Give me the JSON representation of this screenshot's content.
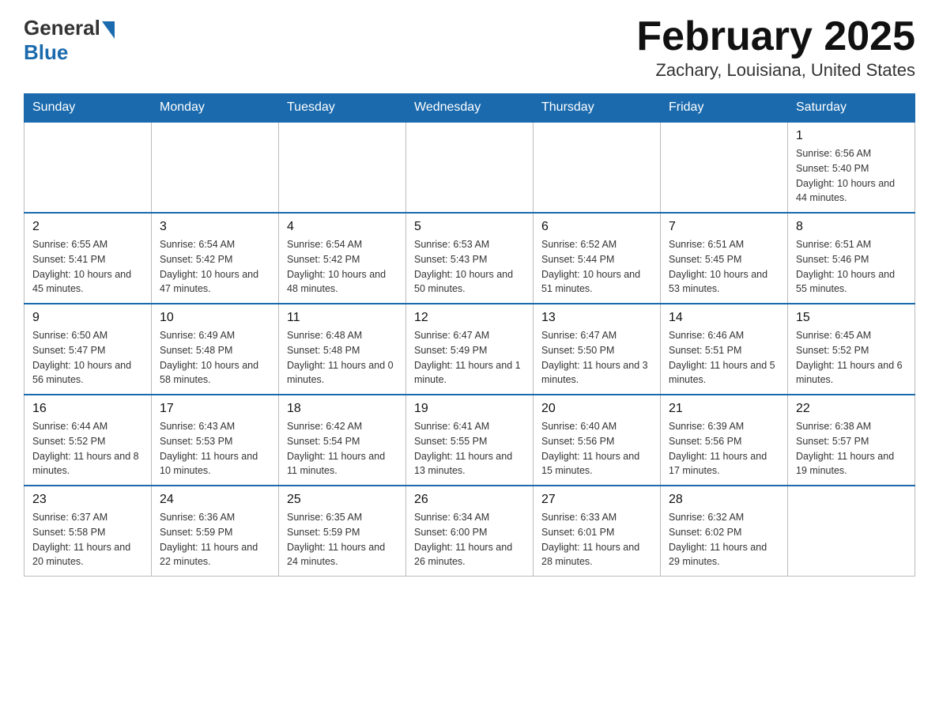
{
  "logo": {
    "general": "General",
    "blue": "Blue"
  },
  "header": {
    "title": "February 2025",
    "location": "Zachary, Louisiana, United States"
  },
  "days_of_week": [
    "Sunday",
    "Monday",
    "Tuesday",
    "Wednesday",
    "Thursday",
    "Friday",
    "Saturday"
  ],
  "weeks": [
    [
      {
        "day": "",
        "info": "",
        "empty": true
      },
      {
        "day": "",
        "info": "",
        "empty": true
      },
      {
        "day": "",
        "info": "",
        "empty": true
      },
      {
        "day": "",
        "info": "",
        "empty": true
      },
      {
        "day": "",
        "info": "",
        "empty": true
      },
      {
        "day": "",
        "info": "",
        "empty": true
      },
      {
        "day": "1",
        "info": "Sunrise: 6:56 AM\nSunset: 5:40 PM\nDaylight: 10 hours and 44 minutes.",
        "empty": false
      }
    ],
    [
      {
        "day": "2",
        "info": "Sunrise: 6:55 AM\nSunset: 5:41 PM\nDaylight: 10 hours and 45 minutes.",
        "empty": false
      },
      {
        "day": "3",
        "info": "Sunrise: 6:54 AM\nSunset: 5:42 PM\nDaylight: 10 hours and 47 minutes.",
        "empty": false
      },
      {
        "day": "4",
        "info": "Sunrise: 6:54 AM\nSunset: 5:42 PM\nDaylight: 10 hours and 48 minutes.",
        "empty": false
      },
      {
        "day": "5",
        "info": "Sunrise: 6:53 AM\nSunset: 5:43 PM\nDaylight: 10 hours and 50 minutes.",
        "empty": false
      },
      {
        "day": "6",
        "info": "Sunrise: 6:52 AM\nSunset: 5:44 PM\nDaylight: 10 hours and 51 minutes.",
        "empty": false
      },
      {
        "day": "7",
        "info": "Sunrise: 6:51 AM\nSunset: 5:45 PM\nDaylight: 10 hours and 53 minutes.",
        "empty": false
      },
      {
        "day": "8",
        "info": "Sunrise: 6:51 AM\nSunset: 5:46 PM\nDaylight: 10 hours and 55 minutes.",
        "empty": false
      }
    ],
    [
      {
        "day": "9",
        "info": "Sunrise: 6:50 AM\nSunset: 5:47 PM\nDaylight: 10 hours and 56 minutes.",
        "empty": false
      },
      {
        "day": "10",
        "info": "Sunrise: 6:49 AM\nSunset: 5:48 PM\nDaylight: 10 hours and 58 minutes.",
        "empty": false
      },
      {
        "day": "11",
        "info": "Sunrise: 6:48 AM\nSunset: 5:48 PM\nDaylight: 11 hours and 0 minutes.",
        "empty": false
      },
      {
        "day": "12",
        "info": "Sunrise: 6:47 AM\nSunset: 5:49 PM\nDaylight: 11 hours and 1 minute.",
        "empty": false
      },
      {
        "day": "13",
        "info": "Sunrise: 6:47 AM\nSunset: 5:50 PM\nDaylight: 11 hours and 3 minutes.",
        "empty": false
      },
      {
        "day": "14",
        "info": "Sunrise: 6:46 AM\nSunset: 5:51 PM\nDaylight: 11 hours and 5 minutes.",
        "empty": false
      },
      {
        "day": "15",
        "info": "Sunrise: 6:45 AM\nSunset: 5:52 PM\nDaylight: 11 hours and 6 minutes.",
        "empty": false
      }
    ],
    [
      {
        "day": "16",
        "info": "Sunrise: 6:44 AM\nSunset: 5:52 PM\nDaylight: 11 hours and 8 minutes.",
        "empty": false
      },
      {
        "day": "17",
        "info": "Sunrise: 6:43 AM\nSunset: 5:53 PM\nDaylight: 11 hours and 10 minutes.",
        "empty": false
      },
      {
        "day": "18",
        "info": "Sunrise: 6:42 AM\nSunset: 5:54 PM\nDaylight: 11 hours and 11 minutes.",
        "empty": false
      },
      {
        "day": "19",
        "info": "Sunrise: 6:41 AM\nSunset: 5:55 PM\nDaylight: 11 hours and 13 minutes.",
        "empty": false
      },
      {
        "day": "20",
        "info": "Sunrise: 6:40 AM\nSunset: 5:56 PM\nDaylight: 11 hours and 15 minutes.",
        "empty": false
      },
      {
        "day": "21",
        "info": "Sunrise: 6:39 AM\nSunset: 5:56 PM\nDaylight: 11 hours and 17 minutes.",
        "empty": false
      },
      {
        "day": "22",
        "info": "Sunrise: 6:38 AM\nSunset: 5:57 PM\nDaylight: 11 hours and 19 minutes.",
        "empty": false
      }
    ],
    [
      {
        "day": "23",
        "info": "Sunrise: 6:37 AM\nSunset: 5:58 PM\nDaylight: 11 hours and 20 minutes.",
        "empty": false
      },
      {
        "day": "24",
        "info": "Sunrise: 6:36 AM\nSunset: 5:59 PM\nDaylight: 11 hours and 22 minutes.",
        "empty": false
      },
      {
        "day": "25",
        "info": "Sunrise: 6:35 AM\nSunset: 5:59 PM\nDaylight: 11 hours and 24 minutes.",
        "empty": false
      },
      {
        "day": "26",
        "info": "Sunrise: 6:34 AM\nSunset: 6:00 PM\nDaylight: 11 hours and 26 minutes.",
        "empty": false
      },
      {
        "day": "27",
        "info": "Sunrise: 6:33 AM\nSunset: 6:01 PM\nDaylight: 11 hours and 28 minutes.",
        "empty": false
      },
      {
        "day": "28",
        "info": "Sunrise: 6:32 AM\nSunset: 6:02 PM\nDaylight: 11 hours and 29 minutes.",
        "empty": false
      },
      {
        "day": "",
        "info": "",
        "empty": true
      }
    ]
  ]
}
